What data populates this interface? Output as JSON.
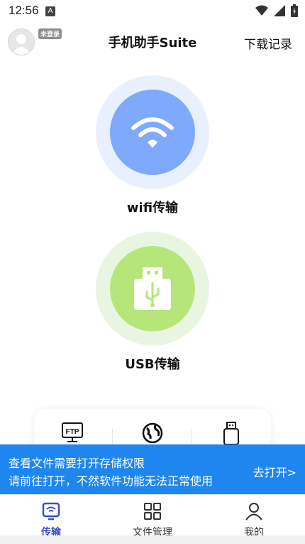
{
  "status_bar": {
    "time": "12:56",
    "notification_glyph": "A"
  },
  "header": {
    "login_badge": "未登录",
    "title": "手机助手Suite",
    "download_label": "下载记录"
  },
  "features": {
    "wifi_label": "wifi传输",
    "usb_label": "USB传输"
  },
  "tools": {
    "ftp_label": "FTP"
  },
  "permission_banner": {
    "line1": "查看文件需要打开存储权限",
    "line2": "请前往打开，不然软件功能无法正常使用",
    "action": "去打开>"
  },
  "bottom_nav": {
    "items": [
      {
        "label": "传输",
        "active": true
      },
      {
        "label": "文件管理",
        "active": false
      },
      {
        "label": "我的",
        "active": false
      }
    ]
  },
  "colors": {
    "accent": "#3a4cc9",
    "banner": "#1f86ef",
    "wifi_circle": "#7fa9fb",
    "usb_circle": "#b6e57a"
  }
}
